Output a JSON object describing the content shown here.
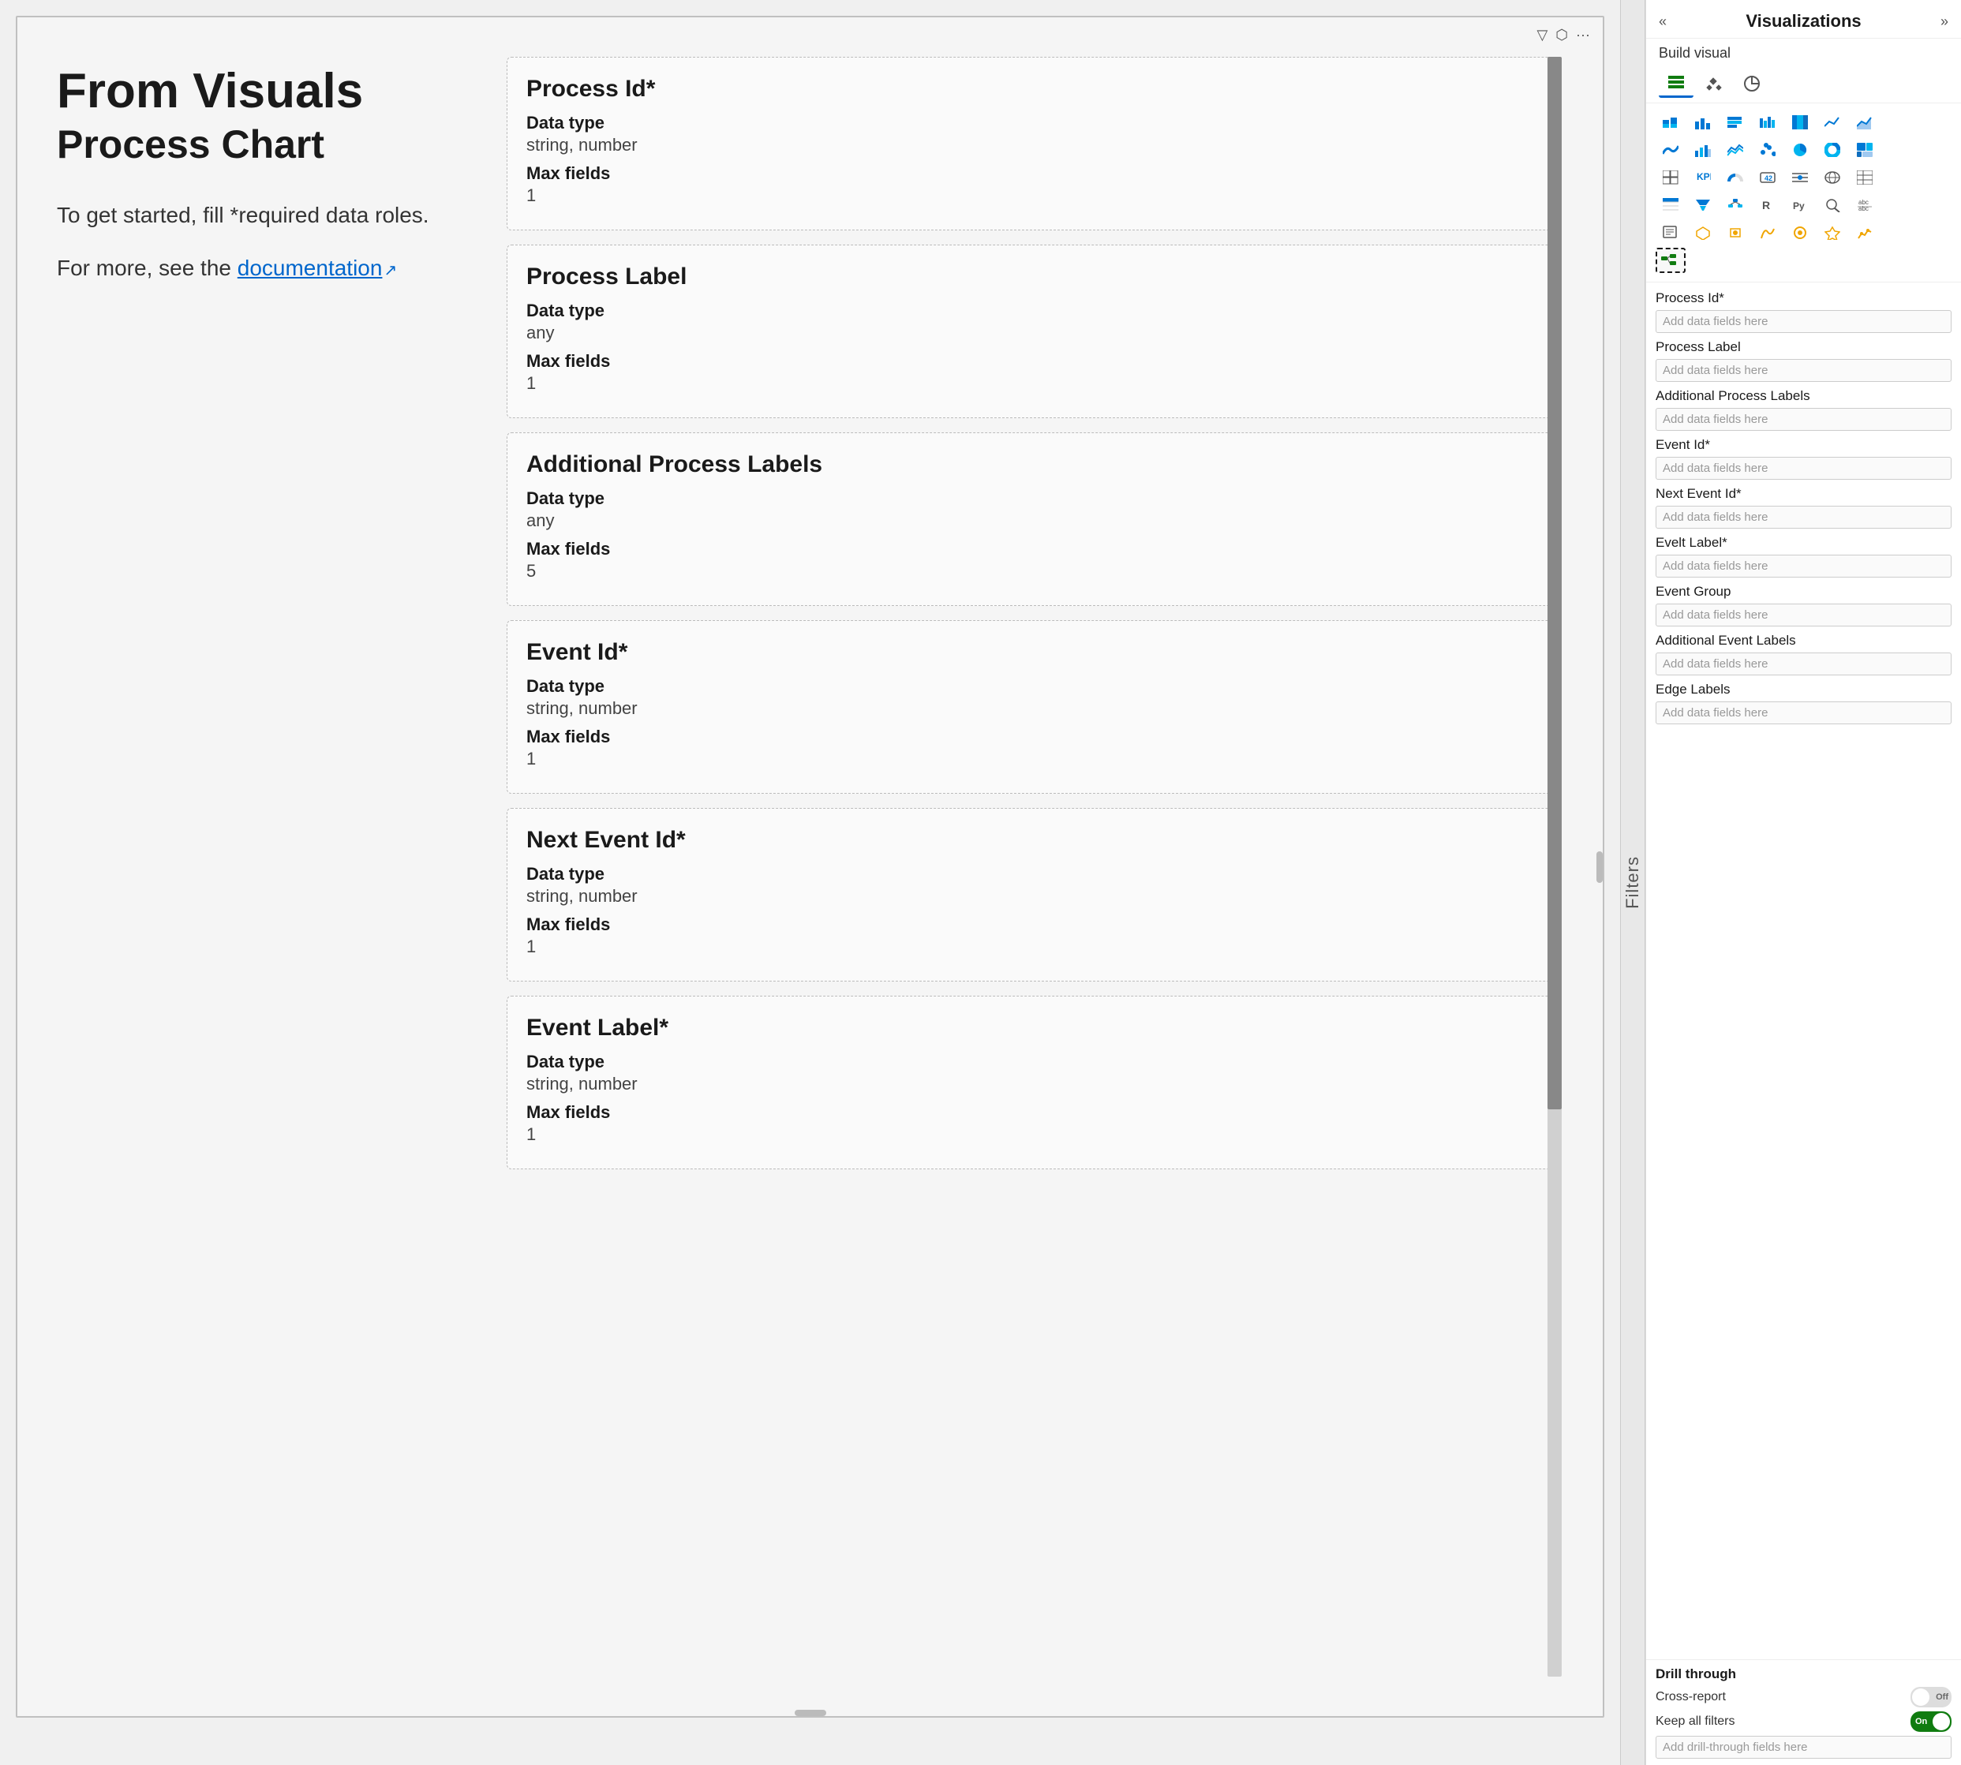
{
  "header": {
    "title": "Visualizations",
    "collapse_left": "«",
    "collapse_right": "»",
    "build_visual_label": "Build visual"
  },
  "canvas": {
    "toolbar_icons": [
      "filter",
      "maximize",
      "more"
    ],
    "intro": {
      "title_main": "From Visuals",
      "title_sub": "Process Chart",
      "body": "To get started, fill *required data roles.",
      "link_text": "For more, see the",
      "link_label": "documentation",
      "link_icon": "↗"
    }
  },
  "filters_sidebar": {
    "label": "Filters"
  },
  "data_cards": [
    {
      "title": "Process Id*",
      "data_type_label": "Data type",
      "data_type_value": "string, number",
      "max_fields_label": "Max fields",
      "max_fields_value": "1"
    },
    {
      "title": "Process Label",
      "data_type_label": "Data type",
      "data_type_value": "any",
      "max_fields_label": "Max fields",
      "max_fields_value": "1"
    },
    {
      "title": "Additional Process Labels",
      "data_type_label": "Data type",
      "data_type_value": "any",
      "max_fields_label": "Max fields",
      "max_fields_value": "5"
    },
    {
      "title": "Event Id*",
      "data_type_label": "Data type",
      "data_type_value": "string, number",
      "max_fields_label": "Max fields",
      "max_fields_value": "1"
    },
    {
      "title": "Next Event Id*",
      "data_type_label": "Data type",
      "data_type_value": "string, number",
      "max_fields_label": "Max fields",
      "max_fields_value": "1"
    },
    {
      "title": "Event Label*",
      "data_type_label": "Data type",
      "data_type_value": "string, number",
      "max_fields_label": "Max fields",
      "max_fields_value": "1"
    }
  ],
  "viz_panel": {
    "field_groups": [
      {
        "label": "Process Id*",
        "placeholder": "Add data fields here"
      },
      {
        "label": "Process Label",
        "placeholder": "Add data fields here"
      },
      {
        "label": "Additional Process Labels",
        "placeholder": "Add data fields here"
      },
      {
        "label": "Event Id*",
        "placeholder": "Add data fields here"
      },
      {
        "label": "Next Event Id*",
        "placeholder": "Add data fields here"
      },
      {
        "label": "Evelt Label*",
        "placeholder": "Add data fields here"
      },
      {
        "label": "Event Group",
        "placeholder": "Add data fields here"
      },
      {
        "label": "Additional Event Labels",
        "placeholder": "Add data fields here"
      },
      {
        "label": "Edge Labels",
        "placeholder": "Add data fields here"
      }
    ],
    "drill_through": {
      "section_label": "Drill through",
      "cross_report_label": "Cross-report",
      "cross_report_toggle": "off",
      "cross_report_toggle_text": "Off",
      "keep_all_filters_label": "Keep all filters",
      "keep_all_filters_toggle": "on",
      "keep_all_filters_toggle_text": "On",
      "drill_field_placeholder": "Add drill-through fields here"
    }
  },
  "viz_icons": [
    [
      "▦",
      "▤",
      "▥",
      "▧",
      "▨",
      "▩",
      "▪"
    ],
    [
      "📈",
      "🔺",
      "📉",
      "🗺",
      "▬",
      "▭",
      "▮"
    ],
    [
      "▯",
      "▰",
      "▱",
      "▲",
      "△",
      "▴",
      "▵"
    ],
    [
      "▶",
      "▷",
      "▸",
      "▹",
      "►",
      "▻",
      "◄"
    ],
    [
      "◅",
      "◆",
      "◇",
      "◈",
      "◉",
      "◊",
      "○"
    ]
  ]
}
